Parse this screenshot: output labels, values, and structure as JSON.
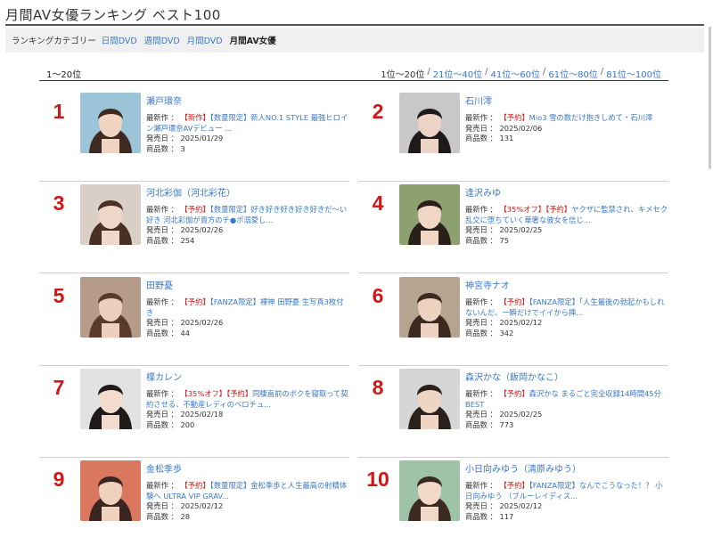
{
  "page": {
    "title": "月間AV女優ランキング ベスト100"
  },
  "categories": {
    "label": "ランキングカテゴリー",
    "links": [
      "日間DVD",
      "週間DVD",
      "月間DVD"
    ],
    "current": "月間AV女優"
  },
  "range": {
    "title": "1〜20位",
    "current": "1位〜20位",
    "links": [
      "21位〜40位",
      "41位〜60位",
      "61位〜80位",
      "81位〜100位"
    ],
    "separator": "/"
  },
  "labels": {
    "latest": "最新作 ：",
    "release": "発売日 ：",
    "count": "商品数 ："
  },
  "actresses": [
    {
      "rank": "1",
      "name": "瀬戸環奈",
      "tag": "【新作】",
      "title": "【数量限定】新人NO.1 STYLE 最強ヒロイン瀬戸環奈AVデビュー ...",
      "release": "2025/01/29",
      "count": "3",
      "bg": "#9cc3d8",
      "skin": "#f1d5c2",
      "hair": "#3d2b22"
    },
    {
      "rank": "2",
      "name": "石川澪",
      "tag": "【予約】",
      "title": "Mio3 雪の数だけ抱きしめて・石川澪",
      "release": "2025/02/06",
      "count": "131",
      "bg": "#c9c7c8",
      "skin": "#ecd3c6",
      "hair": "#1e1a1a"
    },
    {
      "rank": "3",
      "name": "河北彩伽（河北彩花）",
      "tag": "【予約】",
      "title": "【数量限定】好き好き好き好き好きだ〜い好き 河北彩伽が貴方のチ●ポ溺愛し...",
      "release": "2025/02/26",
      "count": "254",
      "bg": "#d9cfc6",
      "skin": "#f0d8c8",
      "hair": "#4a2f24"
    },
    {
      "rank": "4",
      "name": "逢沢みゆ",
      "tag": "【35%オフ】【予約】",
      "title": "ヤクザに監禁され、キメセク乱交に堕ちていく華奢な彼女を信じ...",
      "release": "2025/02/25",
      "count": "75",
      "bg": "#8ca070",
      "skin": "#efd6c5",
      "hair": "#2b1f1a"
    },
    {
      "rank": "5",
      "name": "田野憂",
      "tag": "【予約】",
      "title": "【FANZA限定】裸神 田野憂 生写真3枚付き",
      "release": "2025/02/26",
      "count": "44",
      "bg": "#b79b8a",
      "skin": "#eccfbd",
      "hair": "#5a3a2a"
    },
    {
      "rank": "6",
      "name": "神宮寺ナオ",
      "tag": "【予約】",
      "title": "【FANZA限定】「人生最後の勃起かもしれないんだ、一瞬だけでイイから挿...",
      "release": "2025/02/12",
      "count": "342",
      "bg": "#b5a48f",
      "skin": "#ecd2bf",
      "hair": "#3c2a20"
    },
    {
      "rank": "7",
      "name": "楪カレン",
      "tag": "【35%オフ】【予約】",
      "title": "同棲直前のボクを寝取って契約させる、不動産レディのベロチュ...",
      "release": "2025/02/18",
      "count": "200",
      "bg": "#e2e2e2",
      "skin": "#f3dccd",
      "hair": "#1f1b1b"
    },
    {
      "rank": "8",
      "name": "森沢かな（飯岡かなこ）",
      "tag": "【予約】",
      "title": "森沢かな まるごと完全収録14時間45分BEST",
      "release": "2025/02/25",
      "count": "773",
      "bg": "#d6d6d6",
      "skin": "#eed5c4",
      "hair": "#2a201c"
    },
    {
      "rank": "9",
      "name": "金松季歩",
      "tag": "【予約】",
      "title": "【数量限定】金松季歩と人生最高の射精体験へ ULTRA VIP GRAV...",
      "release": "2025/02/12",
      "count": "28",
      "bg": "#d9785e",
      "skin": "#f0d1bd",
      "hair": "#3a2520"
    },
    {
      "rank": "10",
      "name": "小日向みゆう（清原みゆう）",
      "tag": "【予約】",
      "title": "【FANZA限定】なんでこうなった！？ 小日向みゆう （ブルーレイディス...",
      "release": "2025/02/12",
      "count": "117",
      "bg": "#9ec3a8",
      "skin": "#f1d8c7",
      "hair": "#3b2a22"
    }
  ]
}
